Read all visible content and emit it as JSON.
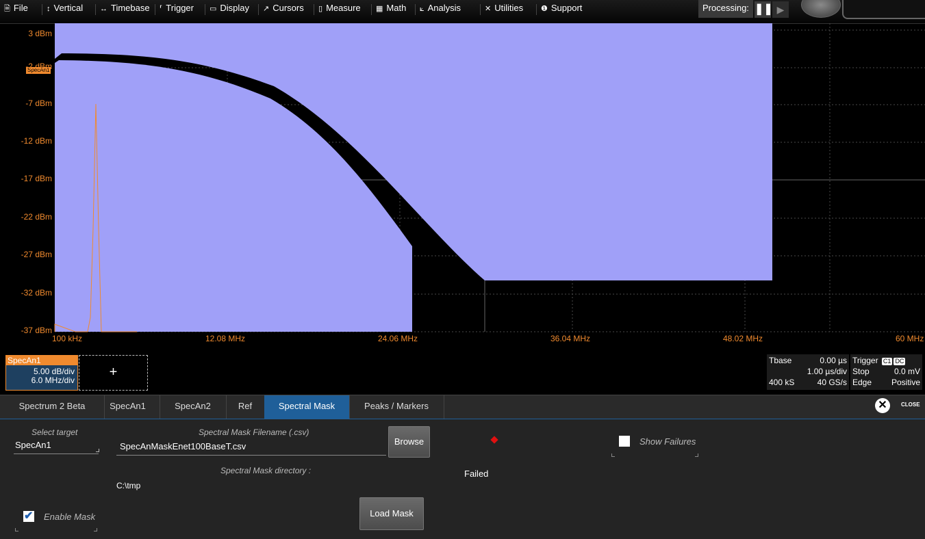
{
  "menu": {
    "items": [
      {
        "icon": "file-icon",
        "glyph": "🗎",
        "label": "File"
      },
      {
        "icon": "vertical-icon",
        "glyph": "↕",
        "label": "Vertical"
      },
      {
        "icon": "timebase-icon",
        "glyph": "↔",
        "label": "Timebase"
      },
      {
        "icon": "trigger-icon",
        "glyph": "⸢",
        "label": "Trigger"
      },
      {
        "icon": "display-icon",
        "glyph": "▭",
        "label": "Display"
      },
      {
        "icon": "cursors-icon",
        "glyph": "↗",
        "label": "Cursors"
      },
      {
        "icon": "measure-icon",
        "glyph": "▯",
        "label": "Measure"
      },
      {
        "icon": "math-icon",
        "glyph": "▦",
        "label": "Math"
      },
      {
        "icon": "analysis-icon",
        "glyph": "⟀",
        "label": "Analysis"
      },
      {
        "icon": "utilities-icon",
        "glyph": "✕",
        "label": "Utilities"
      },
      {
        "icon": "support-icon",
        "glyph": "❶",
        "label": "Support"
      }
    ],
    "processing_label": "Processing:"
  },
  "plot": {
    "trace_tag": "SpecAn1",
    "y_labels": [
      "3 dBm",
      "-2 dBm",
      "-7 dBm",
      "-12 dBm",
      "-17 dBm",
      "-22 dBm",
      "-27 dBm",
      "-32 dBm",
      "-37 dBm"
    ],
    "x_labels": [
      "100 kHz",
      "12.08 MHz",
      "24.06 MHz",
      "36.04 MHz",
      "48.02 MHz",
      "60 MHz"
    ],
    "colors": {
      "mask": "#a0a0f8",
      "trace": "#f08a2e",
      "labels": "#f08a2e",
      "grid": "#555555"
    }
  },
  "descriptor": {
    "title": "SpecAn1",
    "scale": "5.00 dB/div",
    "hdiv": "6.0 MHz/div",
    "add_label": "+"
  },
  "timebase": {
    "title": "Tbase",
    "delay": "0.00 µs",
    "per_div": "1.00 µs/div",
    "samples": "400 kS",
    "rate": "40 GS/s"
  },
  "trigger": {
    "title": "Trigger",
    "chip_channel": "C1",
    "chip_coupling": "DC",
    "mode": "Stop",
    "level": "0.0 mV",
    "type": "Edge",
    "slope": "Positive"
  },
  "tabs": [
    "Spectrum 2 Beta",
    "SpecAn1",
    "SpecAn2",
    "Ref",
    "Spectral Mask",
    "Peaks / Markers"
  ],
  "close_label": "CLOSE",
  "dialog": {
    "select_target_label": "Select target",
    "select_target_value": "SpecAn1",
    "filename_label": "Spectral Mask Filename (.csv)",
    "filename_value": "SpecAnMaskEnet100BaseT.csv",
    "browse_label": "Browse",
    "directory_label": "Spectral Mask directory :",
    "directory_value": "C:\\tmp",
    "status_text": "Failed",
    "status_color": "#e01010",
    "show_failures_label": "Show Failures",
    "show_failures_checked": false,
    "enable_mask_label": "Enable Mask",
    "enable_mask_checked": true,
    "load_mask_label": "Load Mask"
  }
}
